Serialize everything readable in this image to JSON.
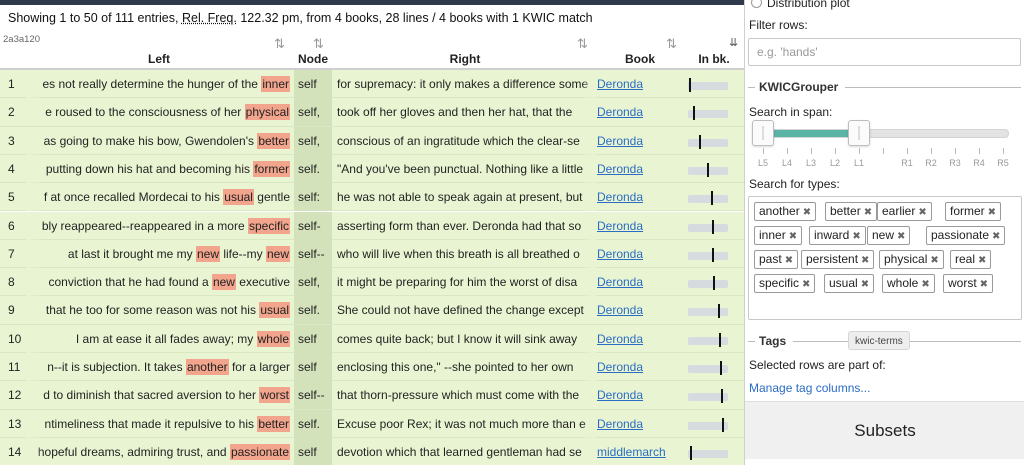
{
  "info": {
    "prefix": "Showing 1 to 50 of 111 entries, ",
    "relfreq_label": "Rel. Freq.",
    "suffix": " 122.32 pm, from 4 books, 28 lines / 4 books with 1 KWIC match"
  },
  "table": {
    "corner_id": "2a3a120",
    "headers": {
      "left": "Left",
      "node": "Node",
      "right": "Right",
      "book": "Book",
      "inbk": "In bk."
    },
    "sort_icon": "⇅",
    "rows": [
      {
        "n": "1",
        "pre": "es not really determine the hunger of the ",
        "kw": "inner",
        "post": "",
        "node": "self",
        "right": "for supremacy: it only makes a difference some",
        "book": "Deronda",
        "pos": 0.02
      },
      {
        "n": "2",
        "pre": "e roused to the consciousness of her ",
        "kw": "physical",
        "post": "",
        "node": "self,",
        "right": "took off her gloves and then her hat, that the",
        "book": "Deronda",
        "pos": 0.12
      },
      {
        "n": "3",
        "pre": "as going to make his bow, Gwendolen's ",
        "kw": "better",
        "post": "",
        "node": "self,",
        "right": "conscious of an ingratitude which the clear-se",
        "book": "Deronda",
        "pos": 0.3
      },
      {
        "n": "4",
        "pre": "putting down his hat and becoming his ",
        "kw": "former",
        "post": "",
        "node": "self.",
        "right": "\"And you've been punctual. Nothing like a little",
        "book": "Deronda",
        "pos": 0.5
      },
      {
        "n": "5",
        "pre": "f at once recalled Mordecai to his ",
        "kw": "usual",
        "post": " gentle",
        "node": "self:",
        "right": "he was not able to speak again at present, but",
        "book": "Deronda",
        "pos": 0.6
      },
      {
        "n": "6",
        "pre": "bly reappeared--reappeared in a more ",
        "kw": "specific",
        "post": "",
        "node": "self-",
        "right": "asserting form than ever. Deronda had that so",
        "book": "Deronda",
        "pos": 0.62
      },
      {
        "n": "7",
        "pre": "at last it brought me my ",
        "kw": "new",
        "post": " life--my ",
        "kw2": "new",
        "node": "self--",
        "right": "who will live when this breath is all breathed o",
        "book": "Deronda",
        "pos": 0.63
      },
      {
        "n": "8",
        "pre": "conviction that he had found a ",
        "kw": "new",
        "post": " executive",
        "node": "self,",
        "right": "it might be preparing for him the worst of disa",
        "book": "Deronda",
        "pos": 0.65
      },
      {
        "n": "9",
        "pre": "that he too for some reason was not his ",
        "kw": "usual",
        "post": "",
        "node": "self.",
        "right": "She could not have defined the change except",
        "book": "Deronda",
        "pos": 0.78
      },
      {
        "n": "10",
        "pre": "I am at ease it all fades away; my ",
        "kw": "whole",
        "post": "",
        "node": "self",
        "right": "comes quite back; but I know it will sink away",
        "book": "Deronda",
        "pos": 0.82
      },
      {
        "n": "11",
        "pre": "n--it is subjection. It takes ",
        "kw": "another",
        "post": " for a larger",
        "node": "self",
        "right": "enclosing this one,\" --she pointed to her own",
        "book": "Deronda",
        "pos": 0.85
      },
      {
        "n": "12",
        "pre": "d to diminish that sacred aversion to her ",
        "kw": "worst",
        "post": "",
        "node": "self--",
        "right": "that thorn-pressure which must come with the",
        "book": "Deronda",
        "pos": 0.88
      },
      {
        "n": "13",
        "pre": "ntimeliness that made it repulsive to his ",
        "kw": "better",
        "post": "",
        "node": "self.",
        "right": "Excuse poor Rex; it was not much more than e",
        "book": "Deronda",
        "pos": 0.9
      },
      {
        "n": "14",
        "pre": "hopeful dreams, admiring trust, and ",
        "kw": "passionate",
        "post": "",
        "node": "self",
        "right": "devotion which that learned gentleman had se",
        "book": "middlemarch",
        "pos": 0.04
      }
    ]
  },
  "panel": {
    "distribution_plot": "Distribution plot",
    "filter_label": "Filter rows:",
    "filter_placeholder": "e.g. 'hands'",
    "kwic_title": "KWICGrouper",
    "span_label": "Search in span:",
    "span_ticks": [
      "L5",
      "L4",
      "L3",
      "L2",
      "L1",
      "",
      "R1",
      "R2",
      "R3",
      "R4",
      "R5"
    ],
    "span_range": [
      "L4",
      "L1"
    ],
    "types_label": "Search for types:",
    "types": [
      "another",
      "better",
      "earlier",
      "former",
      "inner",
      "inward",
      "new",
      "passionate",
      "past",
      "persistent",
      "physical",
      "real",
      "specific",
      "usual",
      "whole",
      "worst"
    ],
    "tags_title": "Tags",
    "tooltip": "kwic-terms",
    "tags_text": "Selected rows are part of:",
    "manage_link": "Manage tag columns...",
    "subsets": "Subsets"
  },
  "colors": {
    "row_bg": "#e9f5d2",
    "keyword_bg": "#f2a58c",
    "node_bg": "#d3e2ba",
    "slider_range": "#5bb5a6",
    "link": "#2b6cc4"
  }
}
